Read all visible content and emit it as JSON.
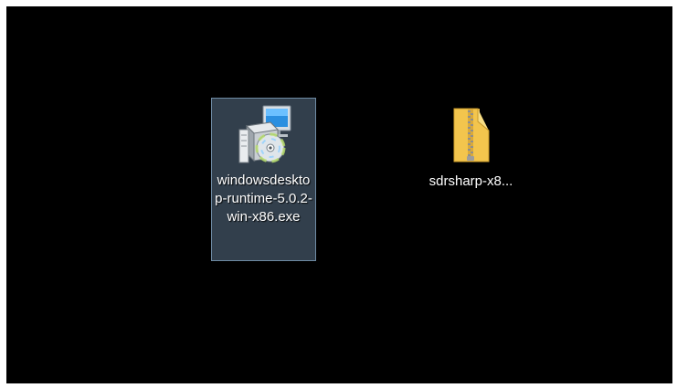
{
  "desktop": {
    "background_color": "#000000",
    "icons": [
      {
        "label": "windowsdesktop-runtime-5.0.2-win-x86.exe",
        "icon": "installer-icon",
        "selected": true,
        "selection_color": "#6e8aa3"
      },
      {
        "label": "sdrsharp-x8...",
        "icon": "zip-folder-icon",
        "selected": false,
        "folder_color": "#f3c54d"
      }
    ]
  }
}
